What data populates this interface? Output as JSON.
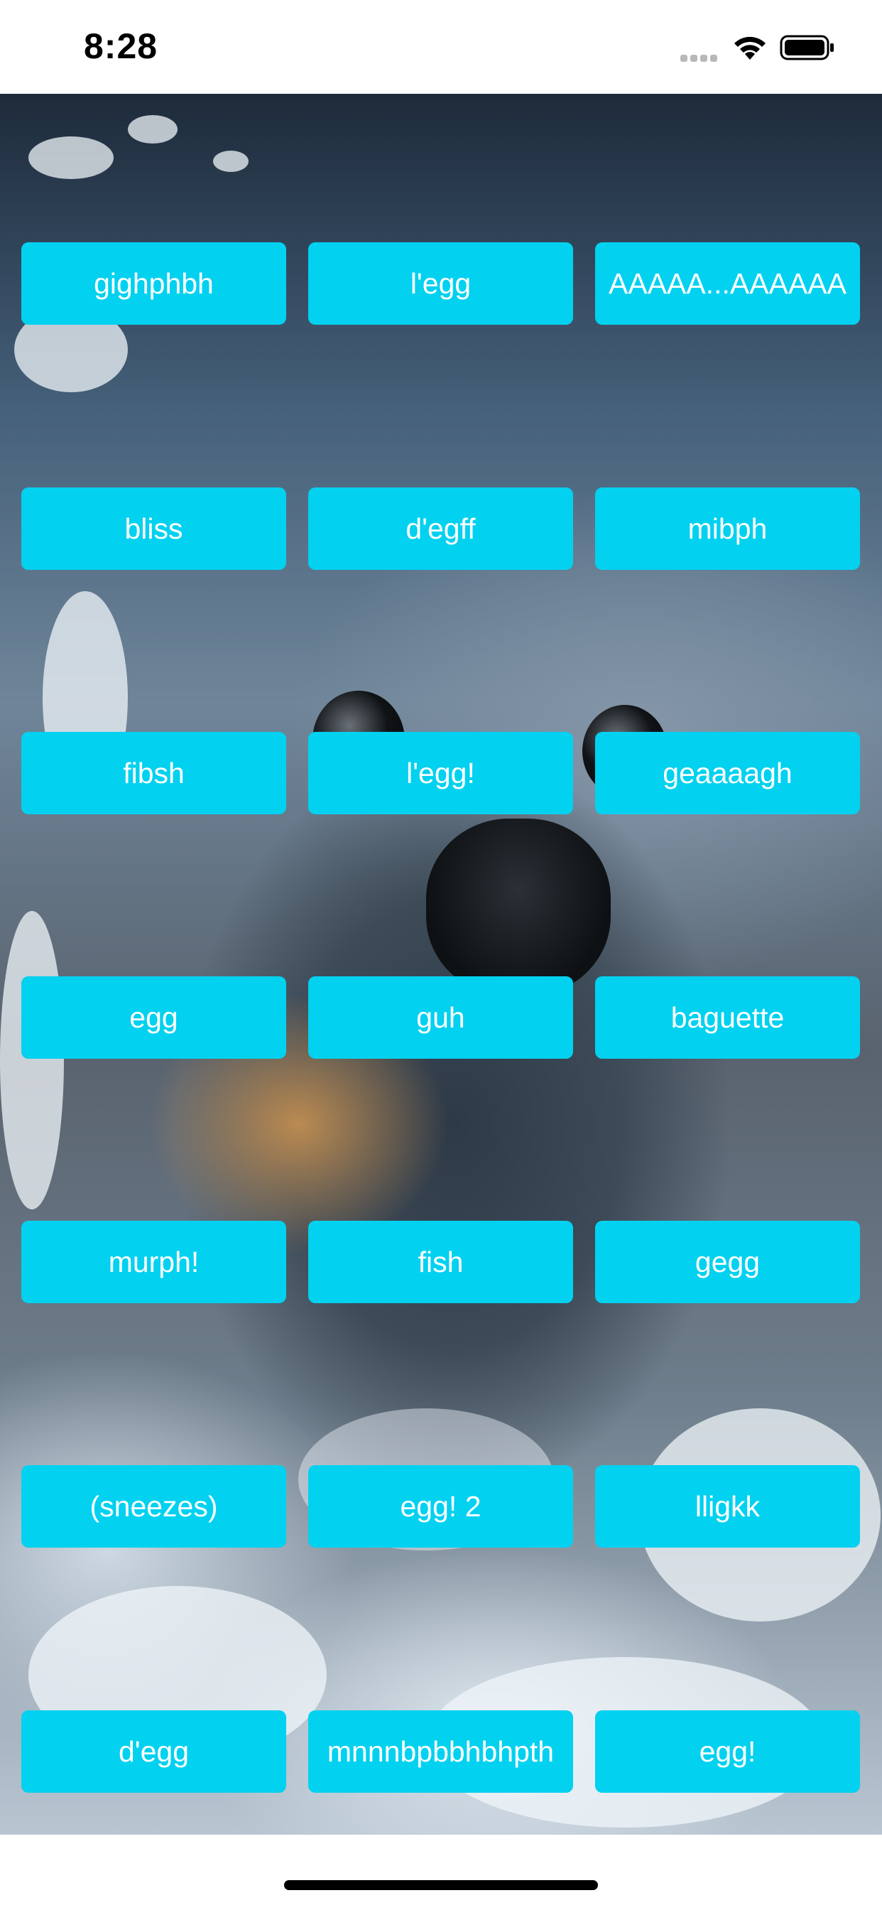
{
  "status_bar": {
    "time": "8:28"
  },
  "icons": {
    "wifi": "wifi-icon",
    "battery": "battery-icon",
    "signal": "cellular-signal-icon"
  },
  "colors": {
    "button_background": "#03d1f0",
    "button_text": "#ffffff"
  },
  "sound_buttons": [
    [
      "gighphbh",
      "l'egg",
      "AAAAA...AAAAAA"
    ],
    [
      "bliss",
      "d'egff",
      "mibph"
    ],
    [
      "fibsh",
      "l'egg!",
      "geaaaagh"
    ],
    [
      "egg",
      "guh",
      "baguette"
    ],
    [
      "murph!",
      "fish",
      "gegg"
    ],
    [
      "(sneezes)",
      "egg! 2",
      "lligkk"
    ],
    [
      "d'egg",
      "mnnnbpbbhbhpth",
      "egg!"
    ]
  ]
}
